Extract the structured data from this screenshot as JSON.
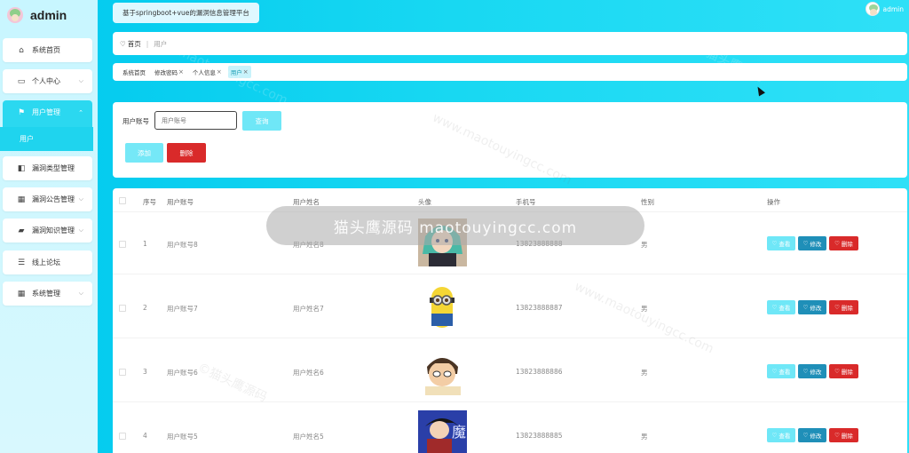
{
  "app": {
    "brand": "admin",
    "top_title": "基于springboot+vue的漏洞信息管理平台",
    "user_name": "admin"
  },
  "sidebar": {
    "items": [
      {
        "label": "系统首页",
        "icon": "home-icon"
      },
      {
        "label": "个人中心",
        "icon": "card-icon"
      },
      {
        "label": "用户管理",
        "icon": "flag-icon"
      },
      {
        "label": "漏洞类型管理",
        "icon": "thumb-icon"
      },
      {
        "label": "漏洞公告管理",
        "icon": "grid-icon"
      },
      {
        "label": "漏洞知识管理",
        "icon": "chat-icon"
      },
      {
        "label": "线上论坛",
        "icon": "list-icon"
      },
      {
        "label": "系统管理",
        "icon": "grid-icon"
      }
    ],
    "sub_active": "用户"
  },
  "breadcrumb": {
    "home": "首页",
    "current": "用户"
  },
  "tags": [
    {
      "label": "系统首页",
      "closable": false
    },
    {
      "label": "修改密码",
      "closable": true
    },
    {
      "label": "个人信息",
      "closable": true
    },
    {
      "label": "用户",
      "closable": true
    }
  ],
  "search": {
    "label": "用户账号",
    "placeholder": "用户账号",
    "query_button": "查询",
    "add_button": "添加",
    "delete_button": "删除"
  },
  "table": {
    "headers": [
      "序号",
      "用户账号",
      "用户姓名",
      "头像",
      "手机号",
      "性别",
      "操作"
    ],
    "rows": [
      {
        "index": "1",
        "account": "用户账号8",
        "name": "用户姓名8",
        "phone": "13823888888",
        "gender": "男"
      },
      {
        "index": "2",
        "account": "用户账号7",
        "name": "用户姓名7",
        "phone": "13823888887",
        "gender": "男"
      },
      {
        "index": "3",
        "account": "用户账号6",
        "name": "用户姓名6",
        "phone": "13823888886",
        "gender": "男"
      },
      {
        "index": "4",
        "account": "用户账号5",
        "name": "用户姓名5",
        "phone": "13823888885",
        "gender": "男"
      }
    ],
    "actions": {
      "view": "查看",
      "edit": "修改",
      "delete": "删除"
    }
  },
  "overlay_text": "猫头鹰源码 maotouyingcc.com",
  "watermark": {
    "text1": "©猫头鹰源码",
    "text2": "www.maotouyingcc.com"
  },
  "colors": {
    "accent": "#1fd4ee",
    "danger": "#d92a2a",
    "edit": "#1f8fb8"
  }
}
